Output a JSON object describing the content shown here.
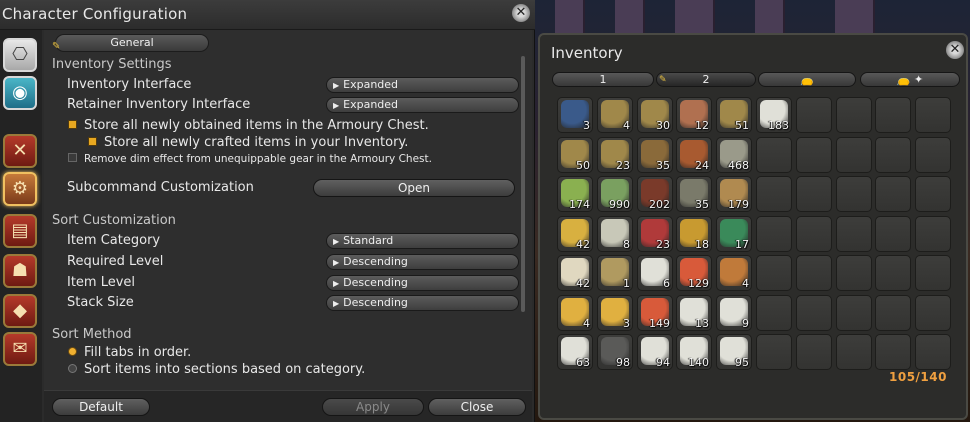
{
  "config": {
    "title": "Character Configuration",
    "tab": "General",
    "inventory_settings": {
      "heading": "Inventory Settings",
      "inventory_interface": {
        "label": "Inventory Interface",
        "value": "Expanded"
      },
      "retainer_interface": {
        "label": "Retainer Inventory Interface",
        "value": "Expanded"
      },
      "store_armoury": {
        "label": "Store all newly obtained items in the Armoury Chest.",
        "checked": true
      },
      "store_crafted": {
        "label": "Store all newly crafted items in your Inventory.",
        "checked": true
      },
      "remove_dim": {
        "label": "Remove dim effect from unequippable gear in the Armoury Chest.",
        "checked": false
      },
      "subcommand_label": "Subcommand Customization",
      "subcommand_button": "Open"
    },
    "sort_customization": {
      "heading": "Sort Customization",
      "item_category": {
        "label": "Item Category",
        "value": "Standard"
      },
      "required_level": {
        "label": "Required Level",
        "value": "Descending"
      },
      "item_level": {
        "label": "Item Level",
        "value": "Descending"
      },
      "stack_size": {
        "label": "Stack Size",
        "value": "Descending"
      }
    },
    "sort_method": {
      "heading": "Sort Method",
      "fill_tabs": {
        "label": "Fill tabs in order.",
        "selected": true
      },
      "sort_sections": {
        "label": "Sort items into sections based on category.",
        "selected": false
      }
    },
    "buttons": {
      "default": "Default",
      "apply": "Apply",
      "close": "Close"
    }
  },
  "inventory": {
    "title": "Inventory",
    "tabs": [
      "1",
      "2",
      "",
      ""
    ],
    "active_tab": "2",
    "capacity": "105/140",
    "slots": [
      {
        "q": "3",
        "c": "#3a5a8a"
      },
      {
        "q": "4",
        "c": "#a0884a"
      },
      {
        "q": "30",
        "c": "#a0884a"
      },
      {
        "q": "12",
        "c": "#b07050"
      },
      {
        "q": "51",
        "c": "#a0884a"
      },
      {
        "q": "50",
        "c": "#a0884a"
      },
      {
        "q": "23",
        "c": "#a0884a"
      },
      {
        "q": "35",
        "c": "#8a6a3a"
      },
      {
        "q": "24",
        "c": "#a85a30"
      },
      {
        "q": "468",
        "c": "#9a9a8a"
      },
      {
        "q": "174",
        "c": "#8ab050"
      },
      {
        "q": "990",
        "c": "#7aa060"
      },
      {
        "q": "202",
        "c": "#7a3a2a"
      },
      {
        "q": "35",
        "c": "#7a7a6a"
      },
      {
        "q": "179",
        "c": "#b08a50"
      },
      {
        "q": "42",
        "c": "#d8b040"
      },
      {
        "q": "8",
        "c": "#c8c8b8"
      },
      {
        "q": "23",
        "c": "#b03a3a"
      },
      {
        "q": "18",
        "c": "#c89a30"
      },
      {
        "q": "17",
        "c": "#3a8a5a"
      },
      {
        "q": "42",
        "c": "#e0d8c0"
      },
      {
        "q": "1",
        "c": "#b09a60"
      },
      {
        "q": "6",
        "c": "#e0e0d8"
      },
      {
        "q": "129",
        "c": "#d85a3a"
      },
      {
        "q": "4",
        "c": "#c07a3a"
      },
      {
        "q": "4",
        "c": "#e0b040"
      },
      {
        "q": "3",
        "c": "#e0b040"
      },
      {
        "q": "149",
        "c": "#d85a3a"
      },
      {
        "q": "13",
        "c": "#e0e0d8"
      },
      {
        "q": "9",
        "c": "#e0e0d8"
      },
      {
        "q": "63",
        "c": "#e0e0d8"
      },
      {
        "q": "98",
        "c": "#5a5a58"
      },
      {
        "q": "94",
        "c": "#e0e0d8"
      },
      {
        "q": "140",
        "c": "#e0e0d8"
      },
      {
        "q": "95",
        "c": "#e0e0d8"
      }
    ],
    "extra_slot": {
      "q": "183",
      "c": "#e0e0d8"
    }
  }
}
